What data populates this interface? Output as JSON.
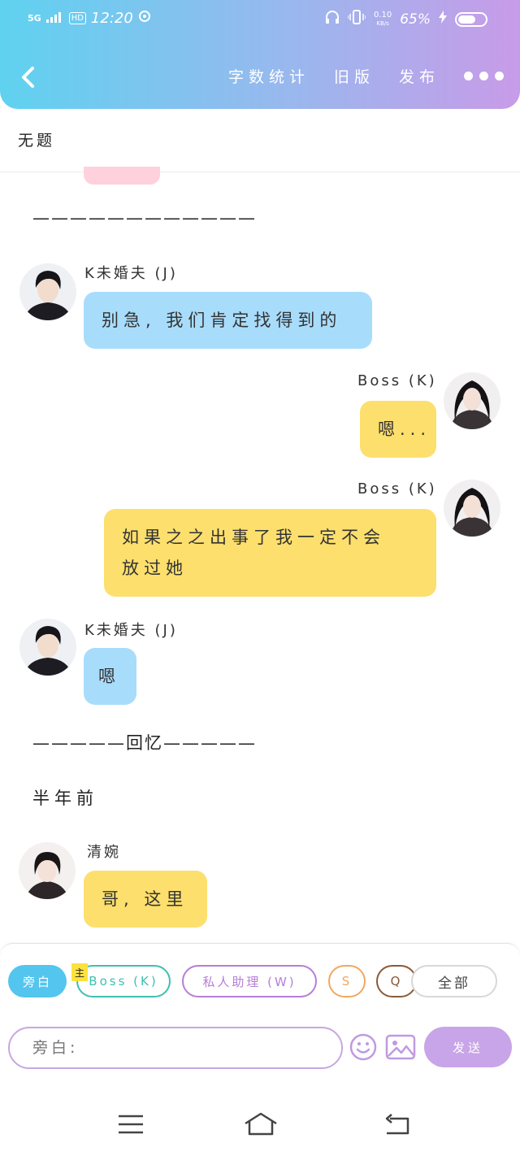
{
  "status_bar": {
    "network": "5G",
    "hd": "HD",
    "time": "12:20",
    "speed_top": "0.10",
    "speed_unit": "KB/s",
    "battery": "65%",
    "battery_level": 0.65
  },
  "header": {
    "actions": [
      "字数统计",
      "旧版",
      "发布"
    ]
  },
  "title": "无题",
  "messages": {
    "divider1": "————————————",
    "m1": {
      "name": "K未婚夫 (J)",
      "text": "别急, 我们肯定找得到的"
    },
    "m2": {
      "name": "Boss (K)",
      "text": "嗯..."
    },
    "m3": {
      "name": "Boss (K)",
      "text_line1": "如果之之出事了我一定不会",
      "text_line2": "放过她"
    },
    "m4": {
      "name": "K未婚夫 (J)",
      "text": "嗯"
    },
    "divider2": "—————回忆—————",
    "narration": "半年前",
    "m5": {
      "name": "清婉",
      "text": "哥, 这里"
    }
  },
  "composer": {
    "chips": [
      "旁白",
      "Boss (K)",
      "私人助理 (W)",
      "S",
      "Q",
      "全部"
    ],
    "main_tag": "主",
    "placeholder": "旁白:",
    "send": "发送"
  },
  "colors": {
    "blue_bubble": "#a8dcfb",
    "yellow_bubble": "#fddf6d",
    "accent_purple": "#c8a4e8",
    "accent_cyan": "#53c5ef"
  }
}
